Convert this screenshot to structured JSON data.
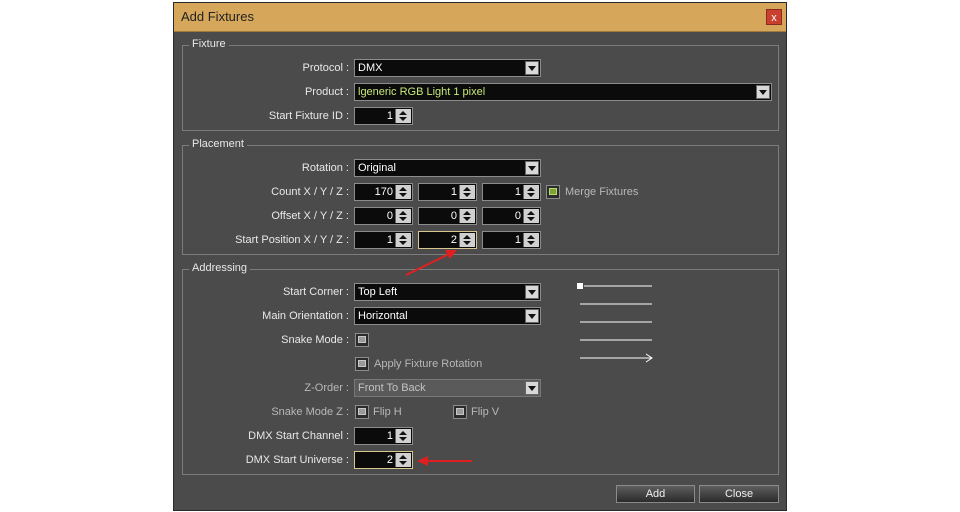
{
  "dialog": {
    "title": "Add Fixtures",
    "close_label": "x"
  },
  "fixture": {
    "legend": "Fixture",
    "protocol_label": "Protocol :",
    "protocol_value": "DMX",
    "product_label": "Product :",
    "product_value": "lgeneric RGB Light 1 pixel",
    "start_id_label": "Start Fixture ID :",
    "start_id_value": "1"
  },
  "placement": {
    "legend": "Placement",
    "rotation_label": "Rotation :",
    "rotation_value": "Original",
    "count_label": "Count X / Y / Z :",
    "count": [
      "170",
      "1",
      "1"
    ],
    "merge_label": "Merge Fixtures",
    "merge_checked": true,
    "offset_label": "Offset X / Y / Z :",
    "offset": [
      "0",
      "0",
      "0"
    ],
    "start_pos_label": "Start Position X / Y / Z :",
    "start_pos": [
      "1",
      "2",
      "1"
    ]
  },
  "addressing": {
    "legend": "Addressing",
    "start_corner_label": "Start Corner :",
    "start_corner_value": "Top Left",
    "main_orientation_label": "Main Orientation :",
    "main_orientation_value": "Horizontal",
    "snake_mode_label": "Snake Mode :",
    "apply_rotation_label": "Apply Fixture Rotation",
    "z_order_label": "Z-Order :",
    "z_order_value": "Front To Back",
    "snake_mode_z_label": "Snake Mode Z :",
    "flip_h_label": "Flip H",
    "flip_v_label": "Flip V",
    "dmx_channel_label": "DMX Start Channel :",
    "dmx_channel_value": "1",
    "dmx_universe_label": "DMX Start Universe :",
    "dmx_universe_value": "2"
  },
  "footer": {
    "add_label": "Add",
    "close_label": "Close"
  },
  "colors": {
    "title_bar": "#d6a75a",
    "dialog_bg": "#4b4b4b",
    "annotation_arrow": "#e02020"
  }
}
